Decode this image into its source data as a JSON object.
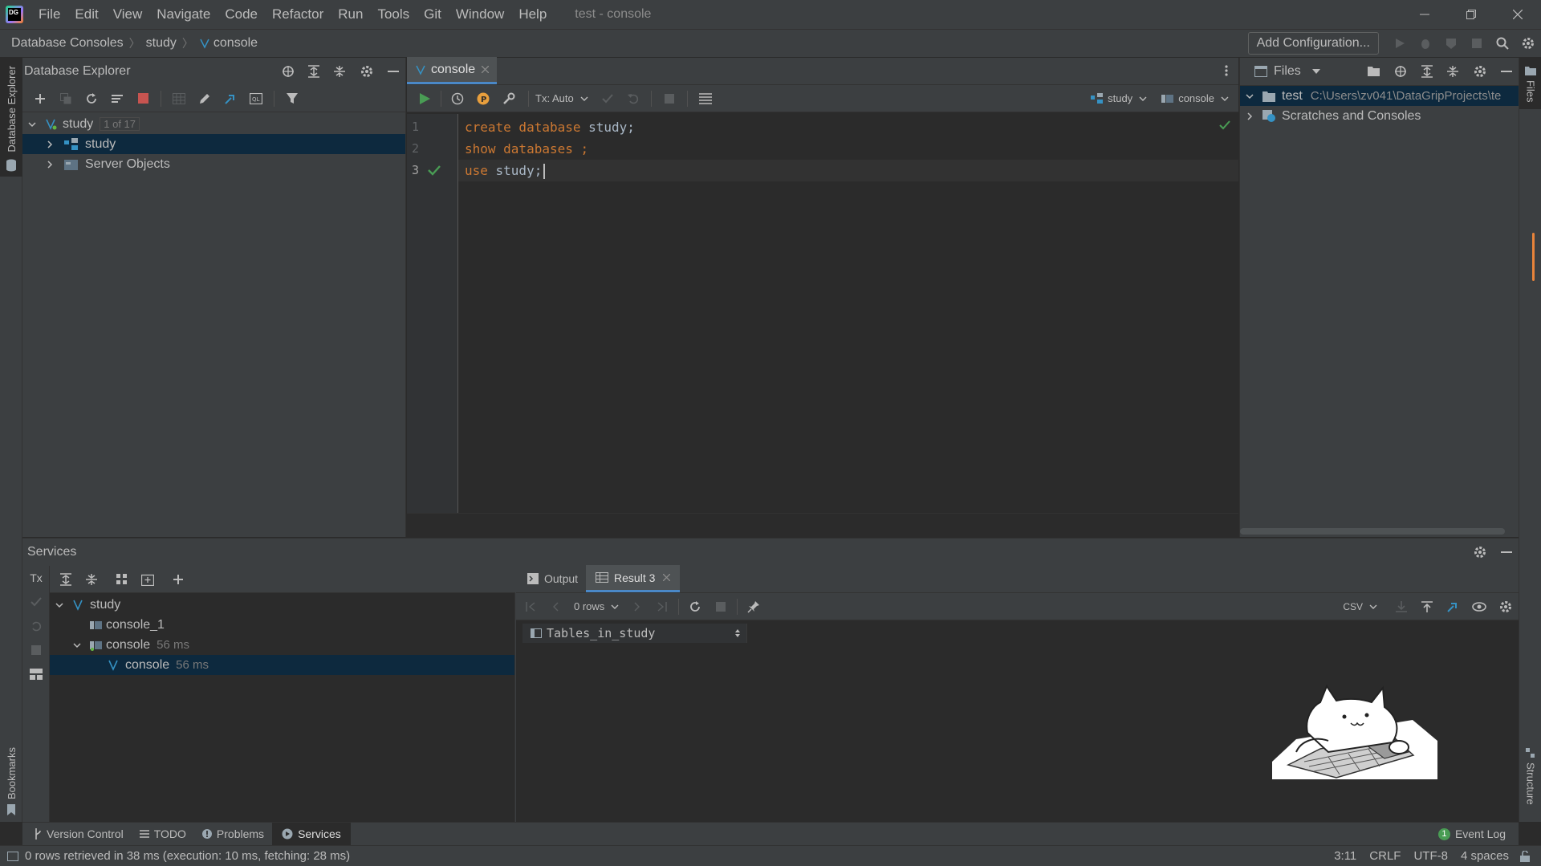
{
  "window": {
    "title": "test - console",
    "app_icon": "datagrip-logo-icon",
    "menu": [
      "File",
      "Edit",
      "View",
      "Navigate",
      "Code",
      "Refactor",
      "Run",
      "Tools",
      "Git",
      "Window",
      "Help"
    ]
  },
  "breadcrumb": [
    "Database Consoles",
    "study",
    "console"
  ],
  "run_toolbar": {
    "add_configuration": "Add Configuration..."
  },
  "database_explorer": {
    "title": "Database Explorer",
    "stripe_label": "Database Explorer",
    "tree": {
      "root": {
        "label": "study",
        "badge": "1 of 17"
      },
      "children": [
        {
          "label": "study",
          "selected": true
        },
        {
          "label": "Server Objects",
          "selected": false
        }
      ]
    }
  },
  "editor": {
    "tab_label": "console",
    "tx_mode": "Tx: Auto",
    "schema_selector": "study",
    "session_selector": "console",
    "lines": [
      {
        "num": "1",
        "tokens": [
          {
            "t": "create database ",
            "k": "kw"
          },
          {
            "t": "study;",
            "k": "id"
          }
        ]
      },
      {
        "num": "2",
        "tokens": [
          {
            "t": "show databases ",
            "k": "kw"
          },
          {
            "t": ";",
            "k": "kw"
          }
        ]
      },
      {
        "num": "3",
        "tokens": [
          {
            "t": "use ",
            "k": "kw"
          },
          {
            "t": "study;",
            "k": "id"
          }
        ]
      }
    ]
  },
  "files_panel": {
    "title": "Files",
    "stripe_label": "Files",
    "project": {
      "label": "test",
      "path": "C:\\Users\\zv041\\DataGripProjects\\te"
    },
    "scratches": "Scratches and Consoles"
  },
  "services": {
    "title": "Services",
    "tree": [
      {
        "label": "study",
        "time": "",
        "level": 0,
        "expanded": true
      },
      {
        "label": "console_1",
        "time": "",
        "level": 1,
        "expanded": false
      },
      {
        "label": "console",
        "time": "56 ms",
        "level": 1,
        "expanded": true
      },
      {
        "label": "console",
        "time": "56 ms",
        "level": 2,
        "selected": true
      }
    ],
    "tabs": {
      "output": "Output",
      "result": "Result 3"
    },
    "rows_label": "0 rows",
    "export_format": "CSV",
    "column_header": "Tables_in_study"
  },
  "left_stripe_bottom": "Bookmarks",
  "right_stripe_bottom": "Structure",
  "tool_windows": [
    "Version Control",
    "TODO",
    "Problems",
    "Services"
  ],
  "event_log": {
    "count": "1",
    "label": "Event Log"
  },
  "status": {
    "message": "0 rows retrieved in 38 ms (execution: 10 ms, fetching: 28 ms)",
    "position": "3:11",
    "line_sep": "CRLF",
    "encoding": "UTF-8",
    "indent": "4 spaces"
  },
  "colors": {
    "accent_green": "#499c54",
    "selection": "#0d293e",
    "keyword": "#cc7832"
  }
}
